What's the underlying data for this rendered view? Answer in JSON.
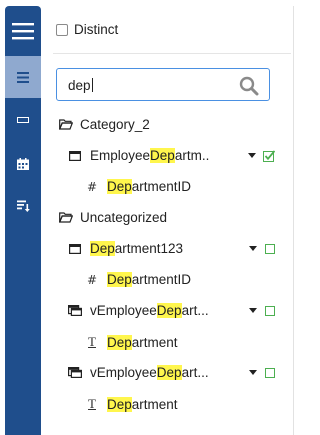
{
  "sidebar": {
    "items": [
      {
        "icon": "hamburger-menu-icon"
      },
      {
        "icon": "list-icon"
      },
      {
        "icon": "minus-icon"
      },
      {
        "icon": "calendar-icon"
      },
      {
        "icon": "sort-filter-icon"
      }
    ]
  },
  "options": {
    "distinct_label": "Distinct"
  },
  "search": {
    "value": "dep",
    "placeholder": ""
  },
  "tree": {
    "category": "Category_2",
    "uncategorized": "Uncategorized",
    "items": [
      {
        "pre": "Employee",
        "hl": "Dep",
        "post": "artm.."
      },
      {
        "pre": "",
        "hl": "Dep",
        "post": "artmentID"
      },
      {
        "pre": "",
        "hl": "Dep",
        "post": "artment123"
      },
      {
        "pre": "",
        "hl": "Dep",
        "post": "artmentID"
      },
      {
        "pre": "vEmployee",
        "hl": "Dep",
        "post": "art..."
      },
      {
        "pre": "",
        "hl": "Dep",
        "post": "artment"
      },
      {
        "pre": "vEmployee",
        "hl": "Dep",
        "post": "art..."
      },
      {
        "pre": "",
        "hl": "Dep",
        "post": "artment"
      }
    ]
  },
  "colors": {
    "sidebar": "#1f4e8c",
    "sidebar_active": "#8fa9cf",
    "search_border": "#4a90e2",
    "highlight": "#fff64d",
    "check_green": "#4caf50"
  }
}
